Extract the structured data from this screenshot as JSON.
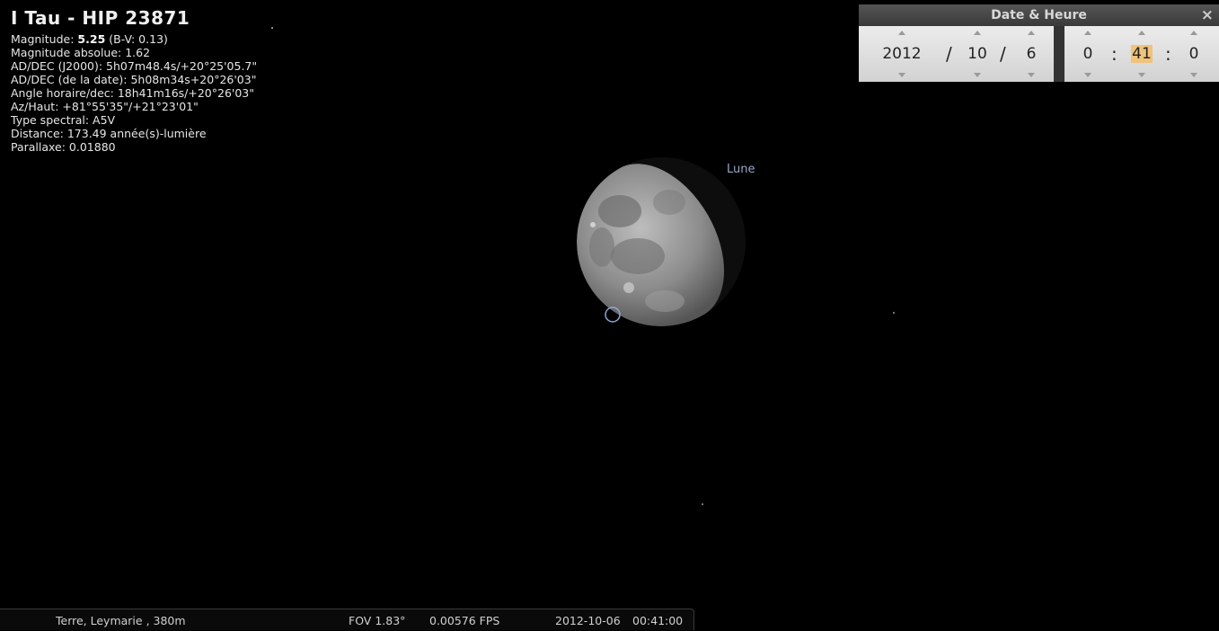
{
  "object": {
    "title": "I Tau - HIP 23871",
    "magnitude_label": "Magnitude: ",
    "magnitude_value": "5.25",
    "magnitude_bv": " (B-V: 0.13)",
    "lines": [
      "Magnitude absolue: 1.62",
      "AD/DEC (J2000): 5h07m48.4s/+20°25'05.7\"",
      "AD/DEC (de la date): 5h08m34s+20°26'03\"",
      "Angle horaire/dec: 18h41m16s/+20°26'03\"",
      "Az/Haut: +81°55'35\"/+21°23'01\"",
      "Type spectral: A5V",
      "Distance: 173.49 année(s)-lumière",
      "Parallaxe: 0.01880"
    ]
  },
  "sky": {
    "moon_label": "Lune"
  },
  "datetime_dialog": {
    "title": "Date & Heure",
    "close_icon": "×",
    "year": "2012",
    "month": "10",
    "day": "6",
    "hour": "0",
    "minute": "41",
    "second": "0",
    "date_sep": "/",
    "time_sep": ":"
  },
  "status_bar": {
    "location": "Terre, Leymarie , 380m",
    "fov": "FOV 1.83°",
    "fps": "0.00576 FPS",
    "date": "2012-10-06",
    "time": "00:41:00"
  },
  "colors": {
    "background": "#000000",
    "highlight": "#f1c27a",
    "moon_label": "#9aa6c7"
  }
}
